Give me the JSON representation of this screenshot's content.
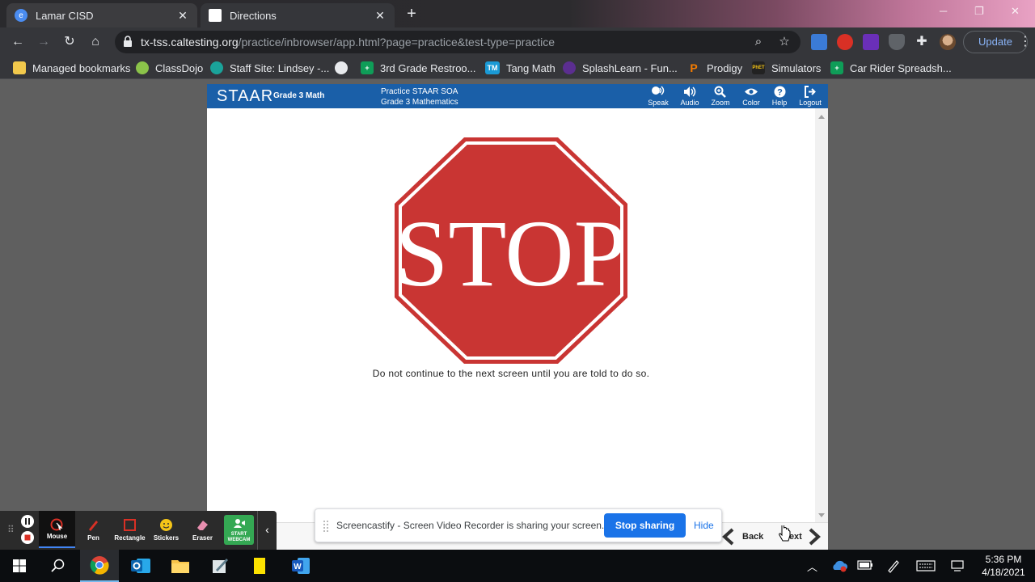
{
  "browser": {
    "tabs": [
      {
        "title": "Lamar CISD",
        "close": "✕"
      },
      {
        "title": "Directions",
        "close": "✕"
      }
    ],
    "new_tab": "+",
    "url_host": "tx-tss.caltesting.org",
    "url_path": "/practice/inbrowser/app.html?page=practice&test-type=practice",
    "update_label": "Update",
    "bookmarks": [
      "Managed bookmarks",
      "ClassDojo",
      "Staff Site: Lindsey -...",
      "",
      "3rd Grade Restroo...",
      "Tang Math",
      "SplashLearn - Fun...",
      "Prodigy",
      "Simulators",
      "Car Rider Spreadsh..."
    ],
    "bookmark_icons": [
      "",
      "",
      "",
      "",
      "",
      "TM",
      "",
      "P",
      "PhET",
      ""
    ]
  },
  "staar": {
    "logo": "STAAR",
    "grade": "Grade 3 Math",
    "test_line1": "Practice STAAR SOA",
    "test_line2": "Grade 3 Mathematics",
    "tools": [
      "Speak",
      "Audio",
      "Zoom",
      "Color",
      "Help",
      "Logout"
    ],
    "stop_text": "STOP",
    "message": "Do not continue to the next screen until you are told to do so.",
    "back_label": "Back",
    "next_label": "Next",
    "colors": {
      "header": "#1a5fa8",
      "stop_red": "#c93533"
    }
  },
  "screencastify": {
    "tools": [
      "Mouse",
      "Pen",
      "Rectangle",
      "Stickers",
      "Eraser",
      "START WEBCAM"
    ],
    "share_message": "Screencastify - Screen Video Recorder is sharing your screen.",
    "stop_sharing": "Stop sharing",
    "hide": "Hide"
  },
  "taskbar": {
    "time": "5:36 PM",
    "date": "4/18/2021"
  }
}
